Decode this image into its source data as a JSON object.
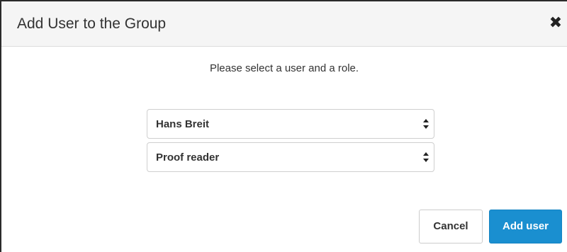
{
  "dialog": {
    "title": "Add User to the Group",
    "close_icon": "close-icon",
    "prompt": "Please select a user and a role.",
    "user_select": {
      "selected": "Hans Breit"
    },
    "role_select": {
      "selected": "Proof reader"
    },
    "cancel_label": "Cancel",
    "add_label": "Add user",
    "colors": {
      "primary": "#1a8fd0",
      "header_bg": "#f5f5f5",
      "text": "#333333"
    }
  }
}
